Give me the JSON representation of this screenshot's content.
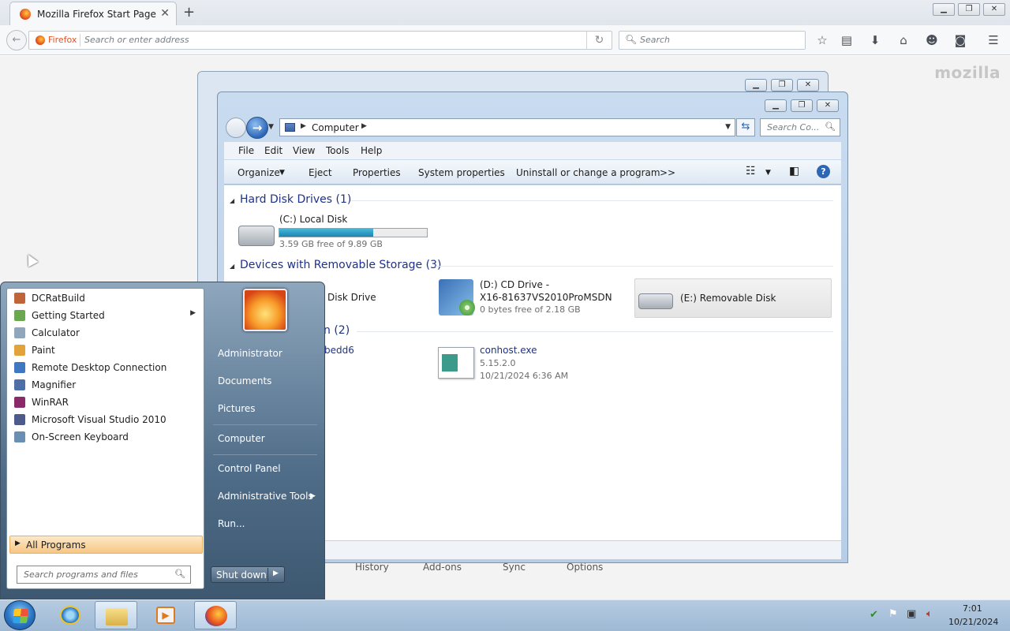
{
  "firefox": {
    "tab_title": "Mozilla Firefox Start Page",
    "identity": "Firefox",
    "url_placeholder": "Search or enter address",
    "search_placeholder": "Search",
    "brand": "mozilla",
    "bottom_links": [
      "History",
      "Add-ons",
      "Sync",
      "Options"
    ]
  },
  "explorer": {
    "location": "Computer",
    "search_placeholder": "Search Co...",
    "menu": [
      "File",
      "Edit",
      "View",
      "Tools",
      "Help"
    ],
    "commands": [
      "Organize",
      "Eject",
      "Properties",
      "System properties",
      "Uninstall or change a program",
      ">>"
    ],
    "groups": {
      "hdd": "Hard Disk Drives (1)",
      "removable": "Devices with Removable Storage (3)",
      "other_partial": "n (2)"
    },
    "drives": {
      "c_name": "(C:) Local Disk",
      "c_free": "3.59 GB free of 9.89 GB",
      "c_used_fraction": 0.637,
      "floppy_partial": "Disk Drive",
      "d_name_line1": "(D:) CD Drive -",
      "d_name_line2": "X16-81637VS2010ProMSDN",
      "d_free": "0 bytes free of 2.18 GB",
      "e_name": "(E:) Removable Disk"
    },
    "other": {
      "partial_item": "bedd6",
      "conhost_name": "conhost.exe",
      "conhost_version": "5.15.2.0",
      "conhost_date": "10/21/2024 6:36 AM"
    }
  },
  "start_menu": {
    "programs": [
      {
        "label": "DCRatBuild",
        "icon": "installer-icon",
        "color": "#c0643a"
      },
      {
        "label": "Getting Started",
        "icon": "getting-started-icon",
        "color": "#6aa84f",
        "submenu": true
      },
      {
        "label": "Calculator",
        "icon": "calculator-icon",
        "color": "#8fa6bd"
      },
      {
        "label": "Paint",
        "icon": "paint-icon",
        "color": "#e2a43a"
      },
      {
        "label": "Remote Desktop Connection",
        "icon": "remote-desktop-icon",
        "color": "#3f77c0"
      },
      {
        "label": "Magnifier",
        "icon": "magnifier-icon",
        "color": "#4f6fa8"
      },
      {
        "label": "WinRAR",
        "icon": "winrar-icon",
        "color": "#8b2a6b"
      },
      {
        "label": "Microsoft Visual Studio 2010",
        "icon": "visual-studio-icon",
        "color": "#4c5a8c"
      },
      {
        "label": "On-Screen Keyboard",
        "icon": "keyboard-icon",
        "color": "#6b8fb3"
      }
    ],
    "all_programs": "All Programs",
    "search_placeholder": "Search programs and files",
    "right_items": [
      "Administrator",
      "Documents",
      "Pictures",
      "Computer",
      "Control Panel",
      "Administrative Tools",
      "Run..."
    ],
    "shutdown": "Shut down"
  },
  "taskbar": {
    "time": "7:01",
    "date": "10/21/2024"
  }
}
